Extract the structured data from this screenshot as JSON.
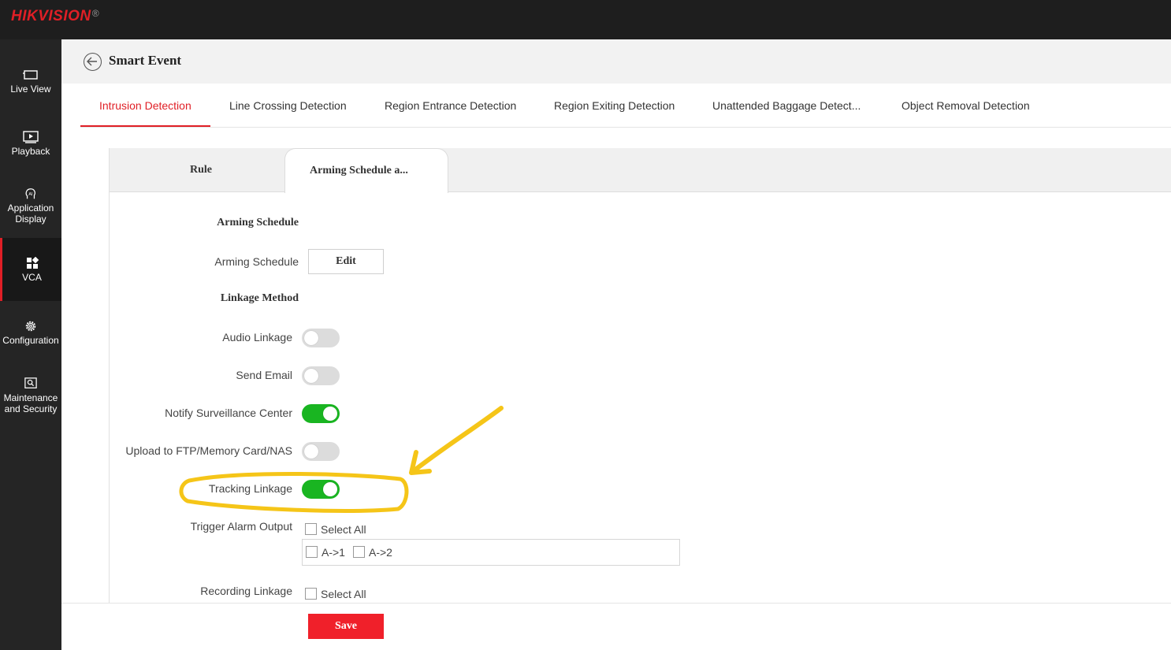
{
  "brand": {
    "logo": "HIKVISION",
    "registered": "®"
  },
  "sidebar": {
    "items": [
      {
        "label": "Live View",
        "icon": "monitor-icon"
      },
      {
        "label": "Playback",
        "icon": "play-icon"
      },
      {
        "label": "Application Display",
        "icon": "ai-head-icon"
      },
      {
        "label": "VCA",
        "icon": "grid-icon",
        "active": true
      },
      {
        "label": "Configuration",
        "icon": "gear-icon"
      },
      {
        "label": "Maintenance and Security",
        "icon": "maintenance-icon"
      }
    ]
  },
  "header": {
    "title": "Smart Event"
  },
  "tabs": [
    {
      "label": "Intrusion Detection",
      "active": true
    },
    {
      "label": "Line Crossing Detection"
    },
    {
      "label": "Region Entrance Detection"
    },
    {
      "label": "Region Exiting Detection"
    },
    {
      "label": "Unattended Baggage Detect..."
    },
    {
      "label": "Object Removal Detection"
    }
  ],
  "subtabs": {
    "rule": "Rule",
    "arming": "Arming Schedule a..."
  },
  "arming": {
    "section_title": "Arming Schedule",
    "row_label": "Arming Schedule",
    "edit_label": "Edit"
  },
  "linkage": {
    "section_title": "Linkage Method",
    "audio": {
      "label": "Audio Linkage",
      "on": false
    },
    "email": {
      "label": "Send Email",
      "on": false
    },
    "notify": {
      "label": "Notify Surveillance Center",
      "on": true
    },
    "upload": {
      "label": "Upload to FTP/Memory Card/NAS",
      "on": false
    },
    "tracking": {
      "label": "Tracking Linkage",
      "on": true
    },
    "alarm": {
      "label": "Trigger Alarm Output",
      "select_all": "Select All",
      "options": [
        "A->1",
        "A->2"
      ]
    },
    "recording": {
      "label": "Recording Linkage",
      "select_all": "Select All"
    }
  },
  "footer": {
    "save_label": "Save"
  },
  "colors": {
    "accent": "#e01f26",
    "toggle_on": "#19b521",
    "annotation": "#f5c518"
  }
}
